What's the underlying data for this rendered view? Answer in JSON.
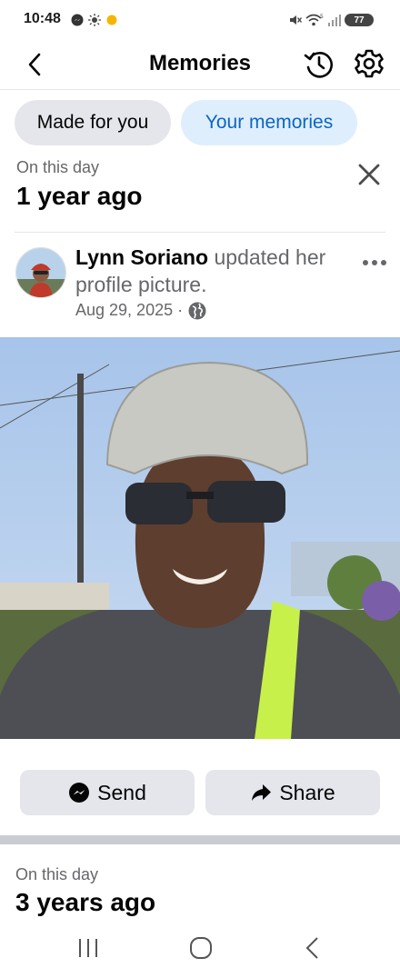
{
  "status_bar": {
    "time": "10:48",
    "battery": "77"
  },
  "header": {
    "title": "Memories"
  },
  "tabs": [
    {
      "label": "Made for you"
    },
    {
      "label": "Your memories"
    }
  ],
  "memory": {
    "on_this_day": "On this day",
    "years_ago": "1 year ago",
    "author": "Lynn Soriano",
    "action_text": " updated her profile picture.",
    "date": "Aug 29, 2025 ·",
    "send_label": "Send",
    "share_label": "Share"
  },
  "next_memory": {
    "on_this_day": "On this day",
    "years_ago": "3 years ago"
  },
  "colors": {
    "accent": "#0a66c2",
    "tab_active_bg": "#dfeefc",
    "button_bg": "#e4e6eb"
  }
}
